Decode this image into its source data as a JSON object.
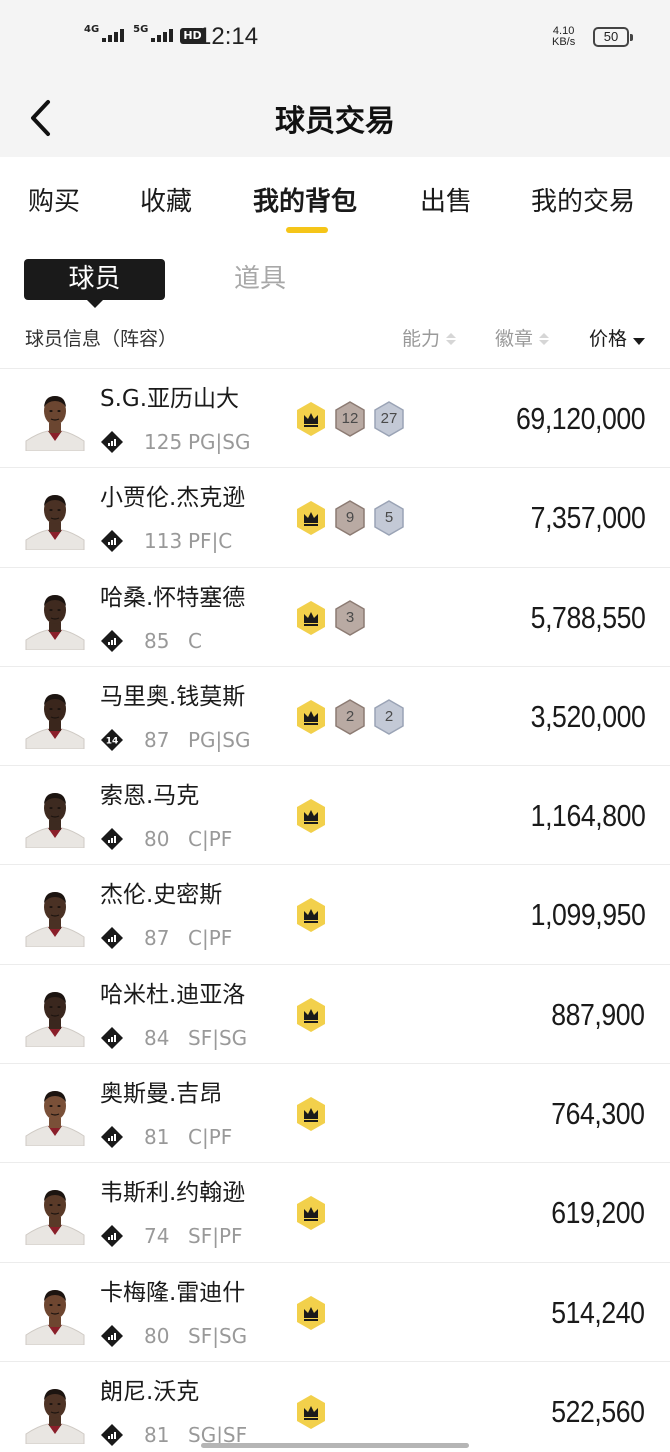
{
  "status_bar": {
    "net_1": "4G",
    "net_2": "5G",
    "hd": "HD",
    "time": "12:14",
    "speed_value": "4.10",
    "speed_unit": "KB/s",
    "battery": "50"
  },
  "header": {
    "title": "球员交易"
  },
  "tabs": [
    {
      "label": "购买"
    },
    {
      "label": "收藏"
    },
    {
      "label": "我的背包"
    },
    {
      "label": "出售"
    },
    {
      "label": "我的交易"
    }
  ],
  "active_tab": "我的背包",
  "segments": {
    "players": "球员",
    "items": "道具"
  },
  "columns": {
    "info": "球员信息（阵容）",
    "ability": "能力",
    "badges": "徽章",
    "price": "价格"
  },
  "colors": {
    "accent": "#f5c518",
    "crown_badge": "#f2d04b",
    "bronze_badge": "#b9aaa3",
    "silver_badge": "#c3c9d6"
  },
  "players": [
    {
      "name": "S.G.亚历山大",
      "overall": "125",
      "position": "PG|SG",
      "badges": [
        {
          "type": "bronze",
          "count": "12"
        },
        {
          "type": "silver",
          "count": "27"
        }
      ],
      "price": "69,120,000",
      "level_icon": "bars",
      "skin": "#6b4631"
    },
    {
      "name": "小贾伦.杰克逊",
      "overall": "113",
      "position": "PF|C",
      "badges": [
        {
          "type": "bronze",
          "count": "9"
        },
        {
          "type": "silver",
          "count": "5"
        }
      ],
      "price": "7,357,000",
      "level_icon": "bars",
      "skin": "#4a3124"
    },
    {
      "name": "哈桑.怀特塞德",
      "overall": "85",
      "position": "C",
      "badges": [
        {
          "type": "bronze",
          "count": "3"
        }
      ],
      "price": "5,788,550",
      "level_icon": "bars",
      "skin": "#3f2a1f"
    },
    {
      "name": "马里奥.钱莫斯",
      "overall": "87",
      "position": "PG|SG",
      "badges": [
        {
          "type": "bronze",
          "count": "2"
        },
        {
          "type": "silver",
          "count": "2"
        }
      ],
      "price": "3,520,000",
      "level_icon": "14",
      "skin": "#3a261c"
    },
    {
      "name": "索恩.马克",
      "overall": "80",
      "position": "C|PF",
      "badges": [],
      "price": "1,164,800",
      "level_icon": "bars",
      "skin": "#3d2a20"
    },
    {
      "name": "杰伦.史密斯",
      "overall": "87",
      "position": "C|PF",
      "badges": [],
      "price": "1,099,950",
      "level_icon": "bars",
      "skin": "#4a3124"
    },
    {
      "name": "哈米杜.迪亚洛",
      "overall": "84",
      "position": "SF|SG",
      "badges": [],
      "price": "887,900",
      "level_icon": "bars",
      "skin": "#3a271e"
    },
    {
      "name": "奥斯曼.吉昂",
      "overall": "81",
      "position": "C|PF",
      "badges": [],
      "price": "764,300",
      "level_icon": "bars",
      "skin": "#7a5038"
    },
    {
      "name": "韦斯利.约翰逊",
      "overall": "74",
      "position": "SF|PF",
      "badges": [],
      "price": "619,200",
      "level_icon": "bars",
      "skin": "#5a3a28"
    },
    {
      "name": "卡梅隆.雷迪什",
      "overall": "80",
      "position": "SF|SG",
      "badges": [],
      "price": "514,240",
      "level_icon": "bars",
      "skin": "#6e4630"
    },
    {
      "name": "朗尼.沃克",
      "overall": "81",
      "position": "SG|SF",
      "badges": [],
      "price": "522,560",
      "level_icon": "bars",
      "skin": "#4e3325"
    }
  ]
}
